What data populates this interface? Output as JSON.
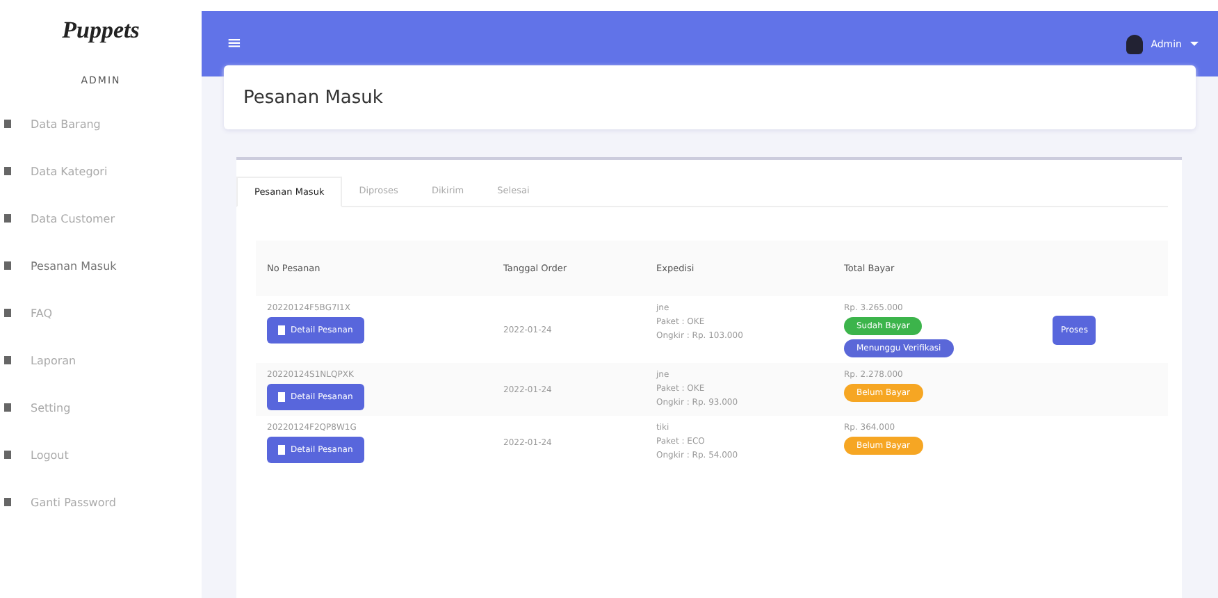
{
  "sidebar": {
    "logo": "Puppets",
    "heading": "ADMIN",
    "items": [
      {
        "label": "Data Barang",
        "selected": false
      },
      {
        "label": "Data Kategori",
        "selected": false
      },
      {
        "label": "Data Customer",
        "selected": false
      },
      {
        "label": "Pesanan Masuk",
        "selected": true
      },
      {
        "label": "FAQ",
        "selected": false
      },
      {
        "label": "Laporan",
        "selected": false
      },
      {
        "label": "Setting",
        "selected": false
      },
      {
        "label": "Logout",
        "selected": false
      },
      {
        "label": "Ganti Password",
        "selected": false
      }
    ]
  },
  "topbar": {
    "menu_icon": "≡",
    "user": "Admin"
  },
  "page_title": "Pesanan Masuk",
  "tabs": [
    {
      "label": "Pesanan Masuk",
      "selected": true
    },
    {
      "label": "Diproses",
      "selected": false
    },
    {
      "label": "Dikirim",
      "selected": false
    },
    {
      "label": "Selesai",
      "selected": false
    }
  ],
  "table": {
    "columns": [
      "No Pesanan",
      "Tanggal Order",
      "Expedisi",
      "Total Bayar"
    ],
    "rows": [
      {
        "no": "20220124F5BG7I1X",
        "detail_button": "Detail Pesanan",
        "date": "2022-01-24",
        "expedisi": [
          "jne",
          "Paket : OKE",
          "Ongkir : Rp. 103.000"
        ],
        "total": "Rp. 3.265.000",
        "badges": [
          {
            "label": "Sudah Bayar",
            "color": "#3cb44b"
          },
          {
            "label": "Menunggu Verifikasi",
            "color": "#5a67d8"
          }
        ],
        "action": "Proses"
      },
      {
        "no": "20220124S1NLQPXK",
        "detail_button": "Detail Pesanan",
        "date": "2022-01-24",
        "expedisi": [
          "jne",
          "Paket : OKE",
          "Ongkir : Rp. 93.000"
        ],
        "total": "Rp. 2.278.000",
        "badges": [
          {
            "label": "Belum Bayar",
            "color": "#f6a623"
          }
        ]
      },
      {
        "no": "20220124F2QP8W1G",
        "detail_button": "Detail Pesanan",
        "date": "2022-01-24",
        "expedisi": [
          "tiki",
          "Paket : ECO",
          "Ongkir : Rp. 54.000"
        ],
        "total": "Rp. 364.000",
        "badges": [
          {
            "label": "Belum Bayar",
            "color": "#f6a623"
          }
        ]
      }
    ]
  }
}
